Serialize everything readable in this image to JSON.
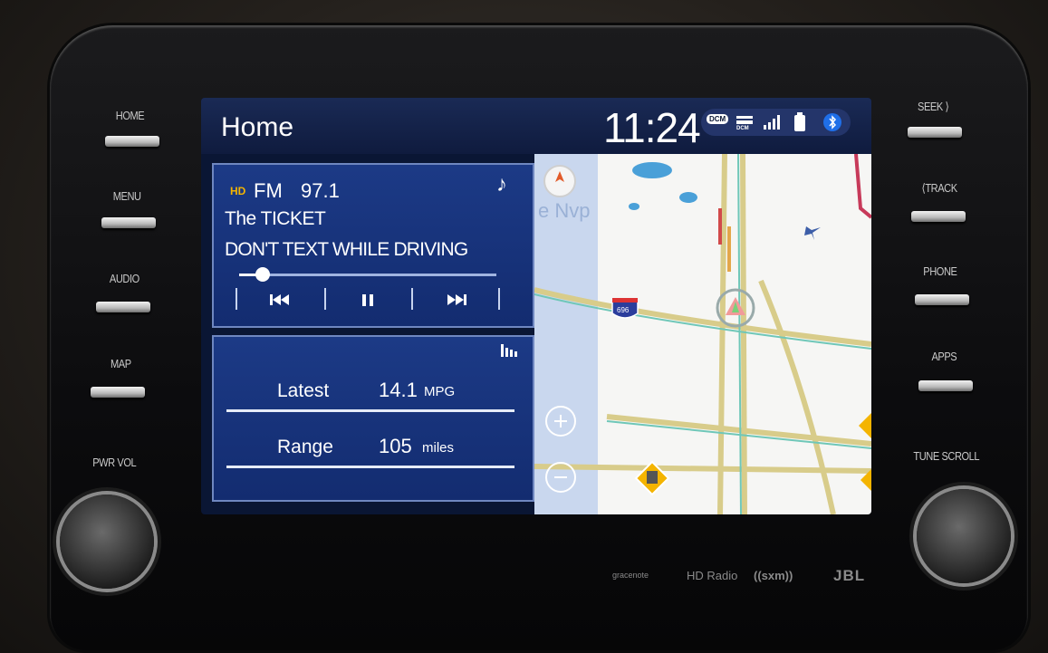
{
  "hardware": {
    "left_buttons": [
      "HOME",
      "MENU",
      "AUDIO",
      "MAP"
    ],
    "right_buttons": [
      "SEEK ⟩",
      "⟨TRACK",
      "PHONE",
      "APPS"
    ],
    "left_knob_label": "PWR VOL",
    "right_knob_label": "TUNE  SCROLL",
    "brand_labels": [
      "gracenote",
      "HD Radio",
      "((sxm))",
      "JBL"
    ]
  },
  "screen": {
    "title": "Home",
    "clock": "11:24",
    "status_badges": [
      "DCM",
      "DCM"
    ],
    "audio": {
      "hd_badge": "HD",
      "band": "FM",
      "frequency": "97.1",
      "station": "The TICKET",
      "song": "DON'T TEXT WHILE DRIVING",
      "progress": 0.09
    },
    "fuel": {
      "latest_label": "Latest",
      "latest_value": "14.1",
      "latest_unit": "MPG",
      "range_label": "Range",
      "range_value": "105",
      "range_unit": "miles"
    },
    "map": {
      "faded_label": "e Nvp",
      "route_shield": "696"
    }
  }
}
